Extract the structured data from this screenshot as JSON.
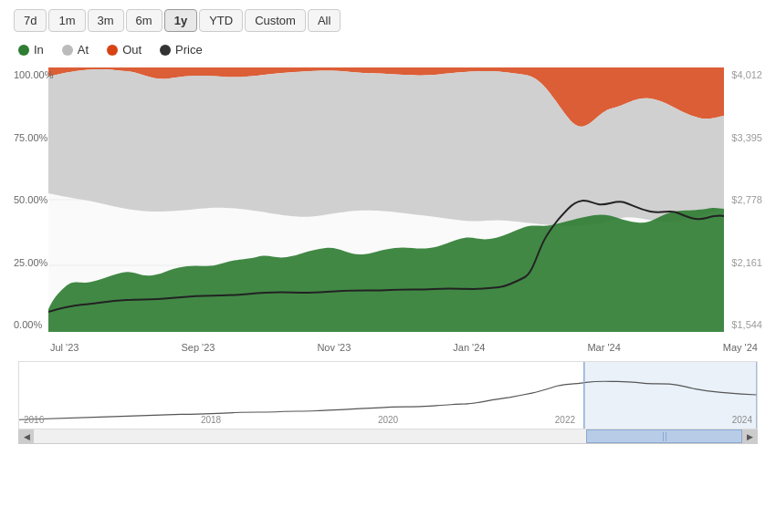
{
  "timeRange": {
    "buttons": [
      "7d",
      "1m",
      "3m",
      "6m",
      "1y",
      "YTD",
      "Custom",
      "All"
    ],
    "active": "1y"
  },
  "legend": [
    {
      "label": "In",
      "color": "#2e7d32"
    },
    {
      "label": "At",
      "color": "#bbb"
    },
    {
      "label": "Out",
      "color": "#d84315"
    },
    {
      "label": "Price",
      "color": "#333"
    }
  ],
  "yAxisRight": [
    "$4,012",
    "$3,395",
    "$2,778",
    "$2,161",
    "$1,544"
  ],
  "yAxisLeft": [
    "100.00%",
    "75.00%",
    "50.00%",
    "25.00%",
    "0.00%"
  ],
  "xAxisLabels": [
    "Jul '23",
    "Sep '23",
    "Nov '23",
    "Jan '24",
    "Mar '24",
    "May '24"
  ],
  "miniXAxisLabels": [
    "2016",
    "2018",
    "2020",
    "2022",
    "2024"
  ],
  "chart": {
    "accent": "#2e7d32",
    "background": "#f5f5f5"
  }
}
